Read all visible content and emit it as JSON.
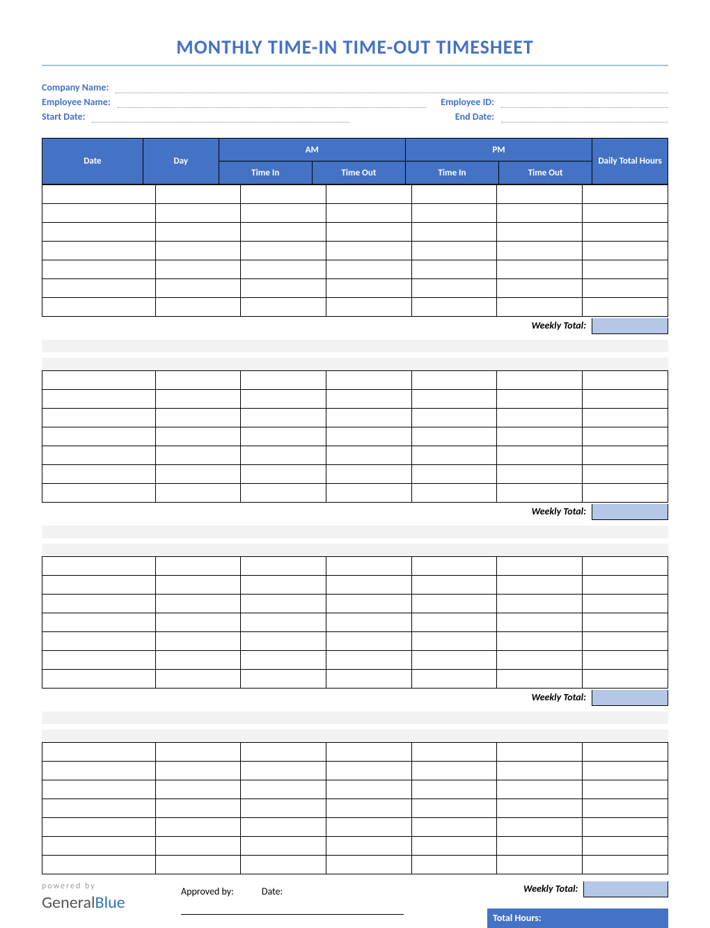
{
  "title": "MONTHLY TIME-IN TIME-OUT TIMESHEET",
  "info": {
    "company_name_label": "Company Name:",
    "employee_name_label": "Employee Name:",
    "employee_id_label": "Employee ID:",
    "start_date_label": "Start Date:",
    "end_date_label": "End Date:"
  },
  "headers": {
    "date": "Date",
    "day": "Day",
    "am": "AM",
    "pm": "PM",
    "time_in": "Time In",
    "time_out": "Time Out",
    "daily_total": "Daily Total Hours"
  },
  "weekly_total_label": "Weekly Total:",
  "weeks": [
    {
      "rows": 7
    },
    {
      "rows": 7
    },
    {
      "rows": 7
    },
    {
      "rows": 7
    }
  ],
  "footer": {
    "powered_by": "powered by",
    "logo_general": "General",
    "logo_blue": "Blue",
    "approved_by": "Approved by:",
    "date": "Date:",
    "total_hours": "Total Hours:"
  }
}
